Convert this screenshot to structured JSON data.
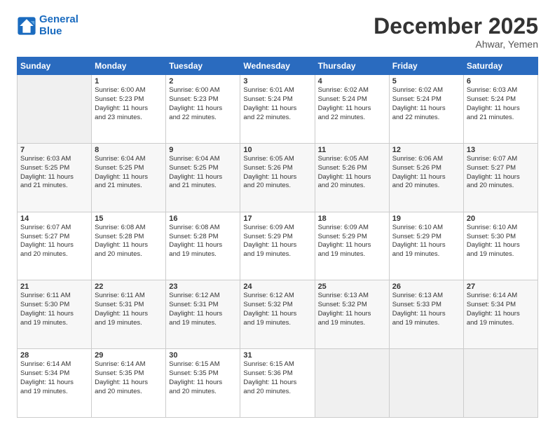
{
  "logo": {
    "line1": "General",
    "line2": "Blue"
  },
  "title": "December 2025",
  "subtitle": "Ahwar, Yemen",
  "days_header": [
    "Sunday",
    "Monday",
    "Tuesday",
    "Wednesday",
    "Thursday",
    "Friday",
    "Saturday"
  ],
  "weeks": [
    [
      {
        "num": "",
        "info": ""
      },
      {
        "num": "1",
        "info": "Sunrise: 6:00 AM\nSunset: 5:23 PM\nDaylight: 11 hours\nand 23 minutes."
      },
      {
        "num": "2",
        "info": "Sunrise: 6:00 AM\nSunset: 5:23 PM\nDaylight: 11 hours\nand 22 minutes."
      },
      {
        "num": "3",
        "info": "Sunrise: 6:01 AM\nSunset: 5:24 PM\nDaylight: 11 hours\nand 22 minutes."
      },
      {
        "num": "4",
        "info": "Sunrise: 6:02 AM\nSunset: 5:24 PM\nDaylight: 11 hours\nand 22 minutes."
      },
      {
        "num": "5",
        "info": "Sunrise: 6:02 AM\nSunset: 5:24 PM\nDaylight: 11 hours\nand 22 minutes."
      },
      {
        "num": "6",
        "info": "Sunrise: 6:03 AM\nSunset: 5:24 PM\nDaylight: 11 hours\nand 21 minutes."
      }
    ],
    [
      {
        "num": "7",
        "info": "Sunrise: 6:03 AM\nSunset: 5:25 PM\nDaylight: 11 hours\nand 21 minutes."
      },
      {
        "num": "8",
        "info": "Sunrise: 6:04 AM\nSunset: 5:25 PM\nDaylight: 11 hours\nand 21 minutes."
      },
      {
        "num": "9",
        "info": "Sunrise: 6:04 AM\nSunset: 5:25 PM\nDaylight: 11 hours\nand 21 minutes."
      },
      {
        "num": "10",
        "info": "Sunrise: 6:05 AM\nSunset: 5:26 PM\nDaylight: 11 hours\nand 20 minutes."
      },
      {
        "num": "11",
        "info": "Sunrise: 6:05 AM\nSunset: 5:26 PM\nDaylight: 11 hours\nand 20 minutes."
      },
      {
        "num": "12",
        "info": "Sunrise: 6:06 AM\nSunset: 5:26 PM\nDaylight: 11 hours\nand 20 minutes."
      },
      {
        "num": "13",
        "info": "Sunrise: 6:07 AM\nSunset: 5:27 PM\nDaylight: 11 hours\nand 20 minutes."
      }
    ],
    [
      {
        "num": "14",
        "info": "Sunrise: 6:07 AM\nSunset: 5:27 PM\nDaylight: 11 hours\nand 20 minutes."
      },
      {
        "num": "15",
        "info": "Sunrise: 6:08 AM\nSunset: 5:28 PM\nDaylight: 11 hours\nand 20 minutes."
      },
      {
        "num": "16",
        "info": "Sunrise: 6:08 AM\nSunset: 5:28 PM\nDaylight: 11 hours\nand 19 minutes."
      },
      {
        "num": "17",
        "info": "Sunrise: 6:09 AM\nSunset: 5:29 PM\nDaylight: 11 hours\nand 19 minutes."
      },
      {
        "num": "18",
        "info": "Sunrise: 6:09 AM\nSunset: 5:29 PM\nDaylight: 11 hours\nand 19 minutes."
      },
      {
        "num": "19",
        "info": "Sunrise: 6:10 AM\nSunset: 5:29 PM\nDaylight: 11 hours\nand 19 minutes."
      },
      {
        "num": "20",
        "info": "Sunrise: 6:10 AM\nSunset: 5:30 PM\nDaylight: 11 hours\nand 19 minutes."
      }
    ],
    [
      {
        "num": "21",
        "info": "Sunrise: 6:11 AM\nSunset: 5:30 PM\nDaylight: 11 hours\nand 19 minutes."
      },
      {
        "num": "22",
        "info": "Sunrise: 6:11 AM\nSunset: 5:31 PM\nDaylight: 11 hours\nand 19 minutes."
      },
      {
        "num": "23",
        "info": "Sunrise: 6:12 AM\nSunset: 5:31 PM\nDaylight: 11 hours\nand 19 minutes."
      },
      {
        "num": "24",
        "info": "Sunrise: 6:12 AM\nSunset: 5:32 PM\nDaylight: 11 hours\nand 19 minutes."
      },
      {
        "num": "25",
        "info": "Sunrise: 6:13 AM\nSunset: 5:32 PM\nDaylight: 11 hours\nand 19 minutes."
      },
      {
        "num": "26",
        "info": "Sunrise: 6:13 AM\nSunset: 5:33 PM\nDaylight: 11 hours\nand 19 minutes."
      },
      {
        "num": "27",
        "info": "Sunrise: 6:14 AM\nSunset: 5:34 PM\nDaylight: 11 hours\nand 19 minutes."
      }
    ],
    [
      {
        "num": "28",
        "info": "Sunrise: 6:14 AM\nSunset: 5:34 PM\nDaylight: 11 hours\nand 19 minutes."
      },
      {
        "num": "29",
        "info": "Sunrise: 6:14 AM\nSunset: 5:35 PM\nDaylight: 11 hours\nand 20 minutes."
      },
      {
        "num": "30",
        "info": "Sunrise: 6:15 AM\nSunset: 5:35 PM\nDaylight: 11 hours\nand 20 minutes."
      },
      {
        "num": "31",
        "info": "Sunrise: 6:15 AM\nSunset: 5:36 PM\nDaylight: 11 hours\nand 20 minutes."
      },
      {
        "num": "",
        "info": ""
      },
      {
        "num": "",
        "info": ""
      },
      {
        "num": "",
        "info": ""
      }
    ]
  ]
}
